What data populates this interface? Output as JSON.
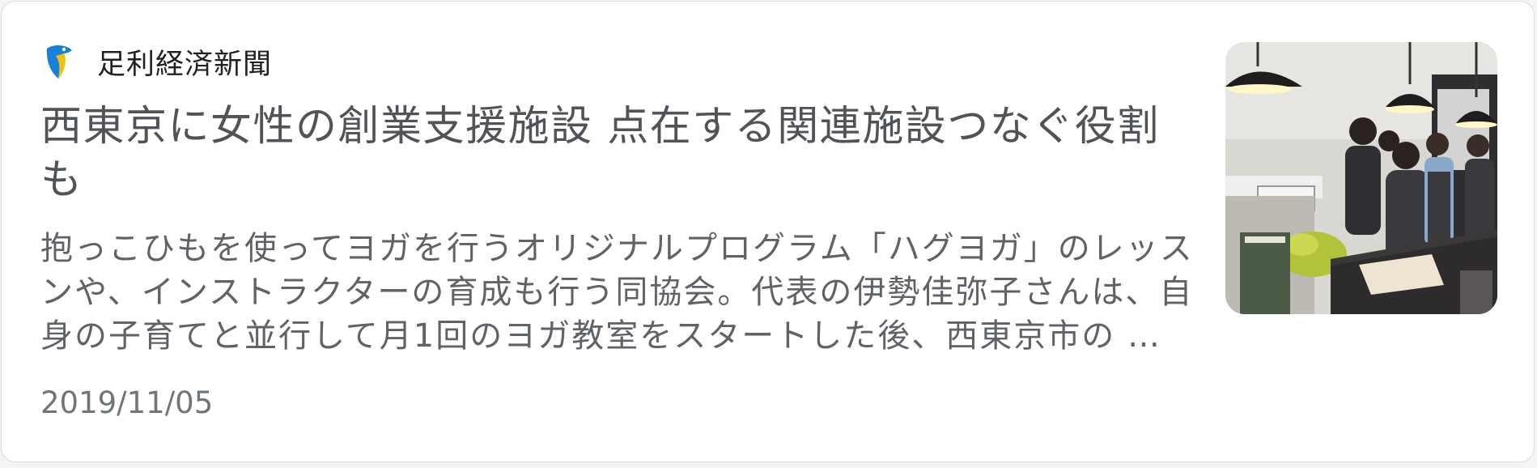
{
  "source": {
    "name": "足利経済新聞",
    "logo_icon": "bird-logo-icon",
    "logo_colors": {
      "body": "#1a7fd6",
      "beak": "#f2c300"
    }
  },
  "article": {
    "headline": "西東京に女性の創業支援施設 点在する関連施設つなぐ役割も",
    "snippet": "抱っこひもを使ってヨガを行うオリジナルプログラム「ハグヨガ」のレッスンや、インストラクターの育成も行う同協会。代表の伊勢佳弥子さんは、自身の子育てと並行して月1回のヨガ教室をスタートした後、西東京市の …",
    "date": "2019/11/05",
    "thumbnail_icon": "article-thumbnail-photo"
  }
}
